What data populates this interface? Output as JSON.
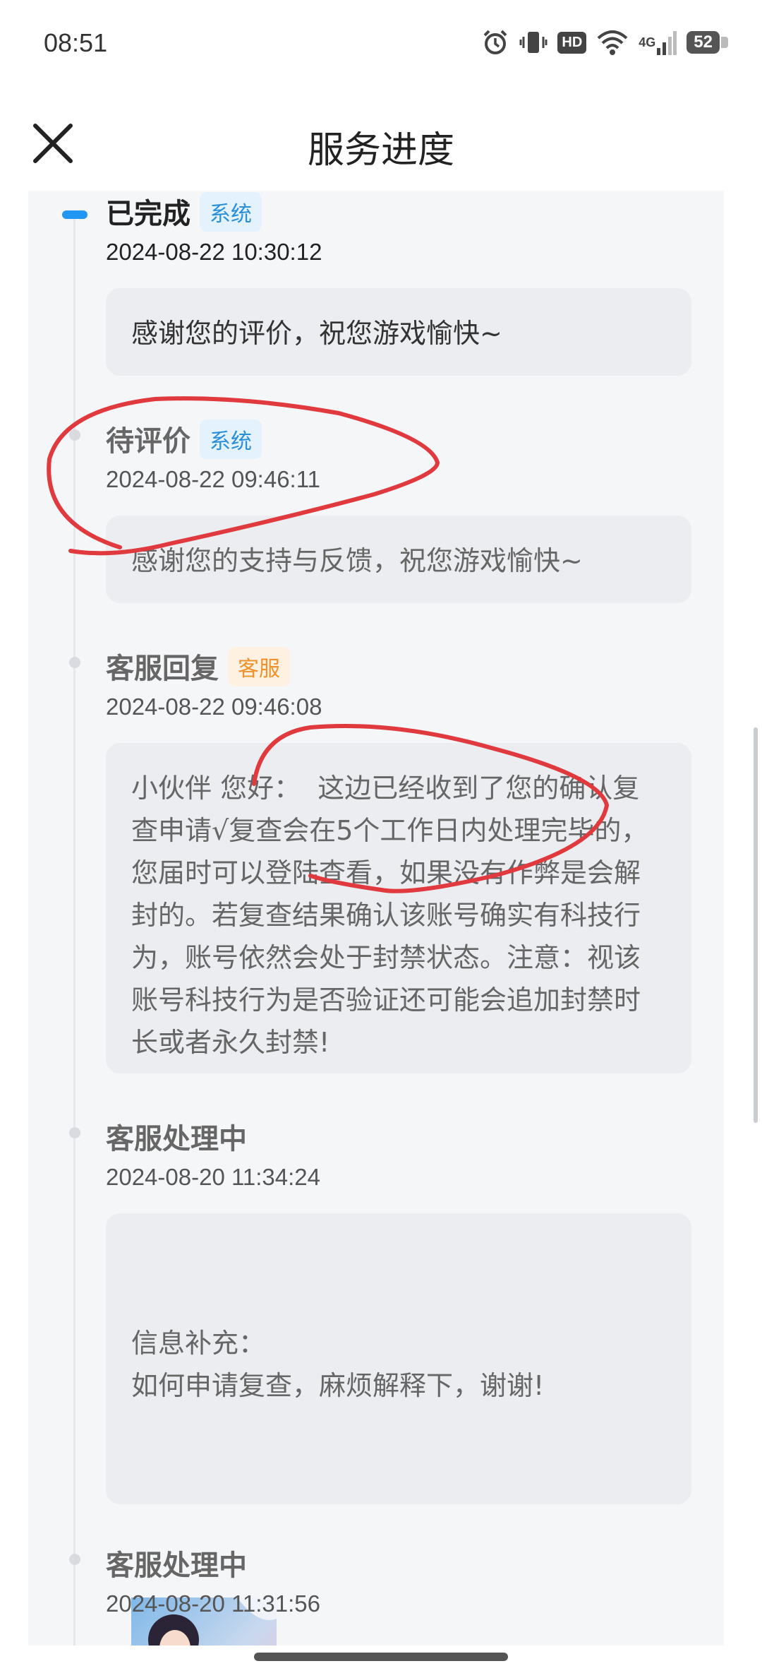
{
  "status_bar": {
    "time": "08:51",
    "icons": [
      "alarm-icon",
      "vibrate-icon",
      "hd-icon",
      "wifi-icon",
      "4g-signal-icon",
      "battery-icon"
    ],
    "hd_label": "HD",
    "network_label": "4G",
    "battery": "52"
  },
  "header": {
    "title": "服务进度",
    "close_icon": "close-icon"
  },
  "colors": {
    "accent": "#2196f3",
    "system_tag_bg": "#e4f2fd",
    "system_tag_text": "#2a8fd9",
    "cs_tag_bg": "#fff1e2",
    "cs_tag_text": "#f0922b",
    "annotation": "#e0393e"
  },
  "timeline": [
    {
      "status": "已完成",
      "tag": "系统",
      "time": "2024-08-22 10:30:12",
      "message": "感谢您的评价，祝您游戏愉快~"
    },
    {
      "status": "待评价",
      "tag": "系统",
      "time": "2024-08-22 09:46:11",
      "message": "感谢您的支持与反馈，祝您游戏愉快~"
    },
    {
      "status": "客服回复",
      "tag": "客服",
      "time": "2024-08-22 09:46:08",
      "message": "小伙伴 您好：  这边已经收到了您的确认复查申请√复查会在5个工作日内处理完毕的，您届时可以登陆查看，如果没有作弊是会解封的。若复查结果确认该账号确实有科技行为，账号依然会处于封禁状态。注意：视该账号科技行为是否验证还可能会追加封禁时长或者永久封禁!"
    },
    {
      "status": "客服处理中",
      "tag": "",
      "time": "2024-08-20 11:34:24",
      "message": "信息补充：\n如何申请复查，麻烦解释下，谢谢!",
      "attachment": "screenshot-thumbnail"
    },
    {
      "status": "客服处理中",
      "tag": "",
      "time": "2024-08-20 11:31:56",
      "message": ""
    }
  ]
}
